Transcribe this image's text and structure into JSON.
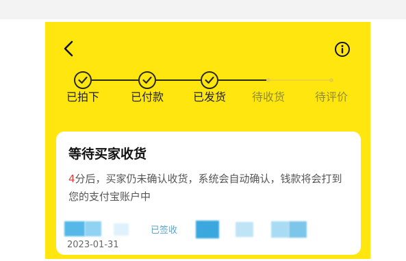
{
  "header": {
    "back_icon": "chevron-left-icon",
    "info_icon": "info-circle-icon"
  },
  "progress": {
    "steps": [
      {
        "label": "已拍下",
        "status": "done"
      },
      {
        "label": "已付款",
        "status": "done"
      },
      {
        "label": "已发货",
        "status": "done"
      },
      {
        "label": "待收货",
        "status": "pending"
      },
      {
        "label": "待评价",
        "status": "pending"
      }
    ]
  },
  "status_card": {
    "title": "等待买家收货",
    "countdown": "4",
    "desc_rest": "分后，买家仍未确认收货，系统会自动确认，钱款将会打到您的支付宝账户中"
  },
  "shipment": {
    "status_label": "已签收",
    "date": "2023-01-31"
  },
  "colors": {
    "header_bg": "#ffe60f",
    "accent_red": "#e43b3b"
  }
}
